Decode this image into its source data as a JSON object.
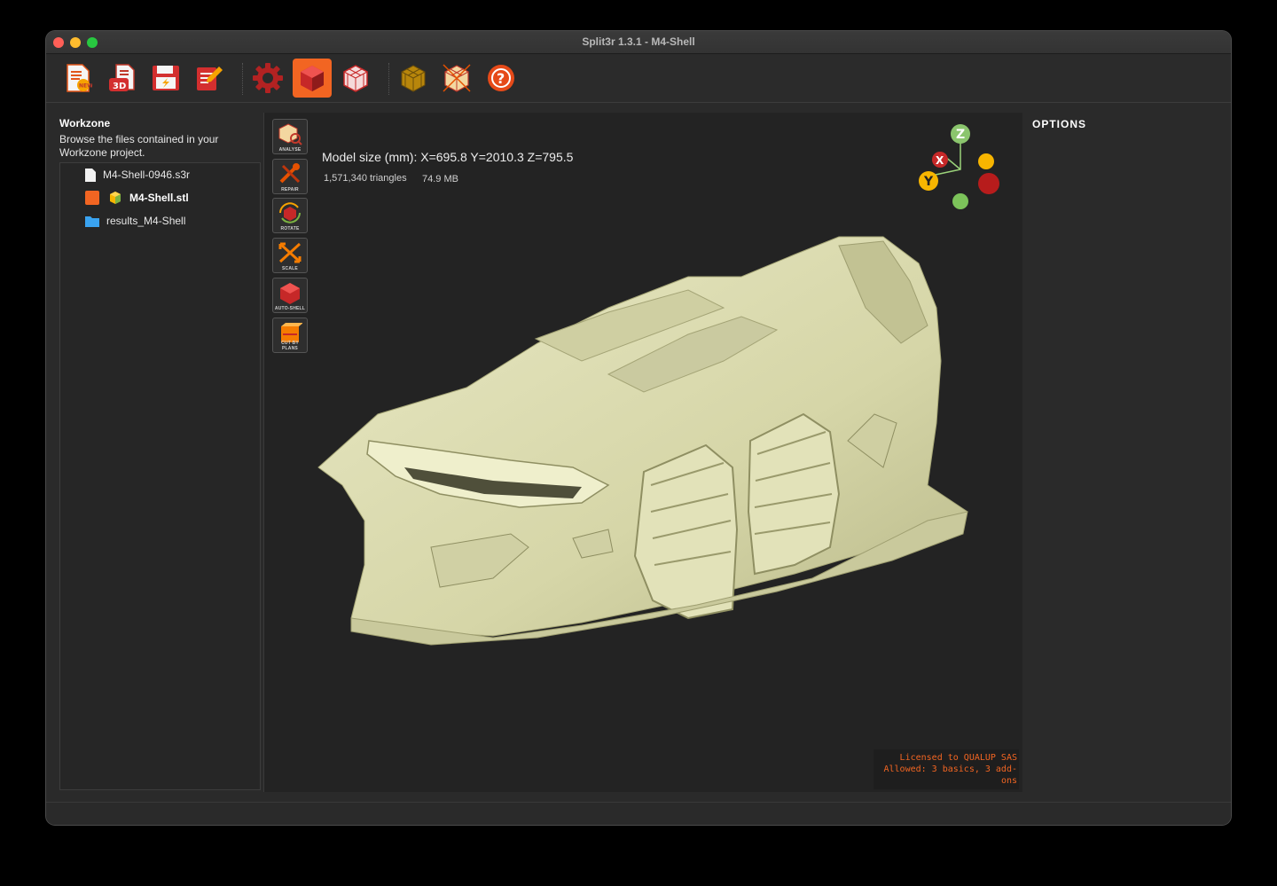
{
  "window": {
    "title": "Split3r 1.3.1 - M4-Shell"
  },
  "toolbar": {
    "buttons": [
      {
        "icon": "new-project-icon"
      },
      {
        "icon": "open-3d-icon"
      },
      {
        "icon": "save-icon"
      },
      {
        "icon": "edit-icon"
      },
      {
        "icon": "settings-gear-icon"
      },
      {
        "icon": "view-solid-icon",
        "active": true
      },
      {
        "icon": "view-wireframe-icon"
      },
      {
        "icon": "parts-icon"
      },
      {
        "icon": "split-icon"
      },
      {
        "icon": "help-icon"
      }
    ],
    "accent": "#f26522"
  },
  "workzone": {
    "title": "Workzone",
    "description": "Browse the files contained in your Workzone project.",
    "files": [
      {
        "name": "M4-Shell-0946.s3r",
        "icon": "file-icon",
        "bold": false
      },
      {
        "name": "M4-Shell.stl",
        "icon": "model-cube-icon",
        "bold": true
      },
      {
        "name": "results_M4-Shell",
        "icon": "folder-icon",
        "bold": false
      }
    ]
  },
  "viewport": {
    "model_size": "Model size (mm): X=695.8 Y=2010.3 Z=795.5",
    "triangles": "1,571,340 triangles",
    "file_size": "74.9 MB",
    "tools": [
      {
        "label": "ANALYSE",
        "icon": "analyse-icon"
      },
      {
        "label": "REPAIR",
        "icon": "repair-icon"
      },
      {
        "label": "ROTATE",
        "icon": "rotate-icon"
      },
      {
        "label": "SCALE",
        "icon": "scale-icon"
      },
      {
        "label": "AUTO-SHELL",
        "icon": "auto-shell-icon"
      },
      {
        "label": "CUT BY PLANS",
        "icon": "cut-by-plans-icon"
      }
    ],
    "gizmo": {
      "x": "X",
      "y": "Y",
      "z": "Z"
    },
    "license_line1": "Licensed to QUALUP SAS",
    "license_line2": "Allowed: 3 basics, 3 add-ons",
    "model_color": "#d9d9b0"
  },
  "options": {
    "title": "OPTIONS"
  }
}
